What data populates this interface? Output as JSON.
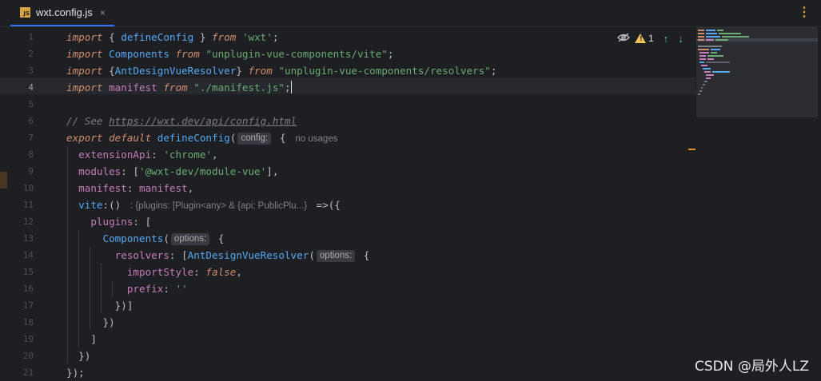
{
  "tab": {
    "badge": "JS",
    "title": "wxt.config.js",
    "close": "×"
  },
  "toolbar": {
    "more": "⋮"
  },
  "indicators": {
    "hidden_icon": "eye-slash-icon",
    "warning_count": "1",
    "warning_glyph": "!",
    "up": "↑",
    "down": "↓"
  },
  "line_numbers": [
    "1",
    "2",
    "3",
    "4",
    "5",
    "6",
    "7",
    "8",
    "9",
    "10",
    "11",
    "12",
    "13",
    "14",
    "15",
    "16",
    "17",
    "18",
    "19",
    "20",
    "21"
  ],
  "code": {
    "l1": {
      "import": "import",
      "open": " { ",
      "name": "defineConfig",
      "close": " } ",
      "from": "from",
      "src": "'wxt'",
      "end": ";"
    },
    "l2": {
      "import": "import",
      "name": " Components ",
      "from": "from",
      "src": " \"unplugin-vue-components/vite\"",
      "end": ";"
    },
    "l3": {
      "import": "import",
      "open": " {",
      "name": "AntDesignVueResolver",
      "close": "} ",
      "from": "from",
      "src": " \"unplugin-vue-components/resolvers\"",
      "end": ";"
    },
    "l4": {
      "import": "import",
      "name": " manifest ",
      "from": "from",
      "src": " \"./manifest.js\"",
      "end": ";"
    },
    "l6": {
      "comment": "// See ",
      "link": "https://wxt.dev/api/config.html"
    },
    "l7": {
      "export": "export",
      "default": " default ",
      "fn": "defineConfig",
      "paren": "(",
      "hint": "config:",
      "brace": " {",
      "usages": "no usages"
    },
    "l8": {
      "key": "  extensionApi",
      "colon": ": ",
      "val": "'chrome'",
      "end": ","
    },
    "l9": {
      "key": "  modules",
      "colon": ": [",
      "val": "'@wxt-dev/module-vue'",
      "end": "],"
    },
    "l10": {
      "key": "  manifest",
      "colon": ": ",
      "val": "manifest",
      "end": ","
    },
    "l11": {
      "key": "  vite",
      "colon": ":() ",
      "type": ": {plugins: [Plugin<any> & {api: PublicPlu...}",
      "end": " =>({"
    },
    "l12": {
      "key": "    plugins",
      "end": ": ["
    },
    "l13": {
      "fn": "      Components",
      "paren": "(",
      "hint": "options:",
      "end": " {"
    },
    "l14": {
      "key": "        resolvers",
      "colon": ": [",
      "fn": "AntDesignVueResolver",
      "paren": "(",
      "hint": "options:",
      "end": " {"
    },
    "l15": {
      "key": "          importStyle",
      "colon": ": ",
      "val": "false",
      "end": ","
    },
    "l16": {
      "key": "          prefix",
      "colon": ": ",
      "val": "''"
    },
    "l17": {
      "text": "        })]"
    },
    "l18": {
      "text": "      })"
    },
    "l19": {
      "text": "    ]"
    },
    "l20": {
      "text": "  })"
    },
    "l21": {
      "text": "});"
    }
  },
  "watermark": "CSDN @局外人LZ"
}
